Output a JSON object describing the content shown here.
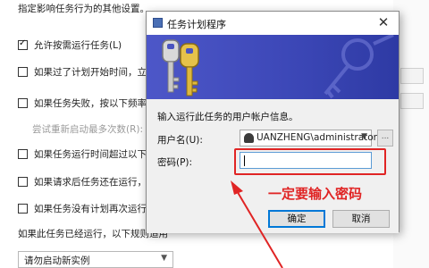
{
  "background_panel": {
    "header_text": "指定影响任务行为的其他设置。",
    "options": [
      {
        "label": "允许按需运行任务(L)",
        "checked": true
      },
      {
        "label": "如果过了计划开始时间，立即启",
        "checked": false
      },
      {
        "label": "如果任务失败，按以下频率重新启",
        "checked": false
      },
      {
        "label": "尝试重新启动最多次数(R):",
        "checked": null,
        "disabled": true
      },
      {
        "label": "如果任务运行时间超过以下时间",
        "checked": false
      },
      {
        "label": "如果请求后任务还在运行，强行",
        "checked": false
      },
      {
        "label": "如果任务没有计划再次运行，则",
        "checked": false
      }
    ],
    "running_rule_text": "如果此任务已经运行，以下规则适用",
    "running_rule_value": "请勿启动新实例"
  },
  "dialog": {
    "title": "任务计划程序",
    "close_glyph": "✕",
    "prompt": "输入运行此任务的用户帐户信息。",
    "username_label": "用户名(U):",
    "username_value": "UANZHENG\\administrator",
    "browse_label": "...",
    "password_label": "密码(P):",
    "password_value": "",
    "ok_label": "确定",
    "cancel_label": "取消"
  },
  "annotation": {
    "text": "一定要输入密码",
    "color": "#e02424"
  },
  "colors": {
    "banner": "#3d48b8",
    "highlight": "#e02424",
    "focus": "#0078d7"
  }
}
